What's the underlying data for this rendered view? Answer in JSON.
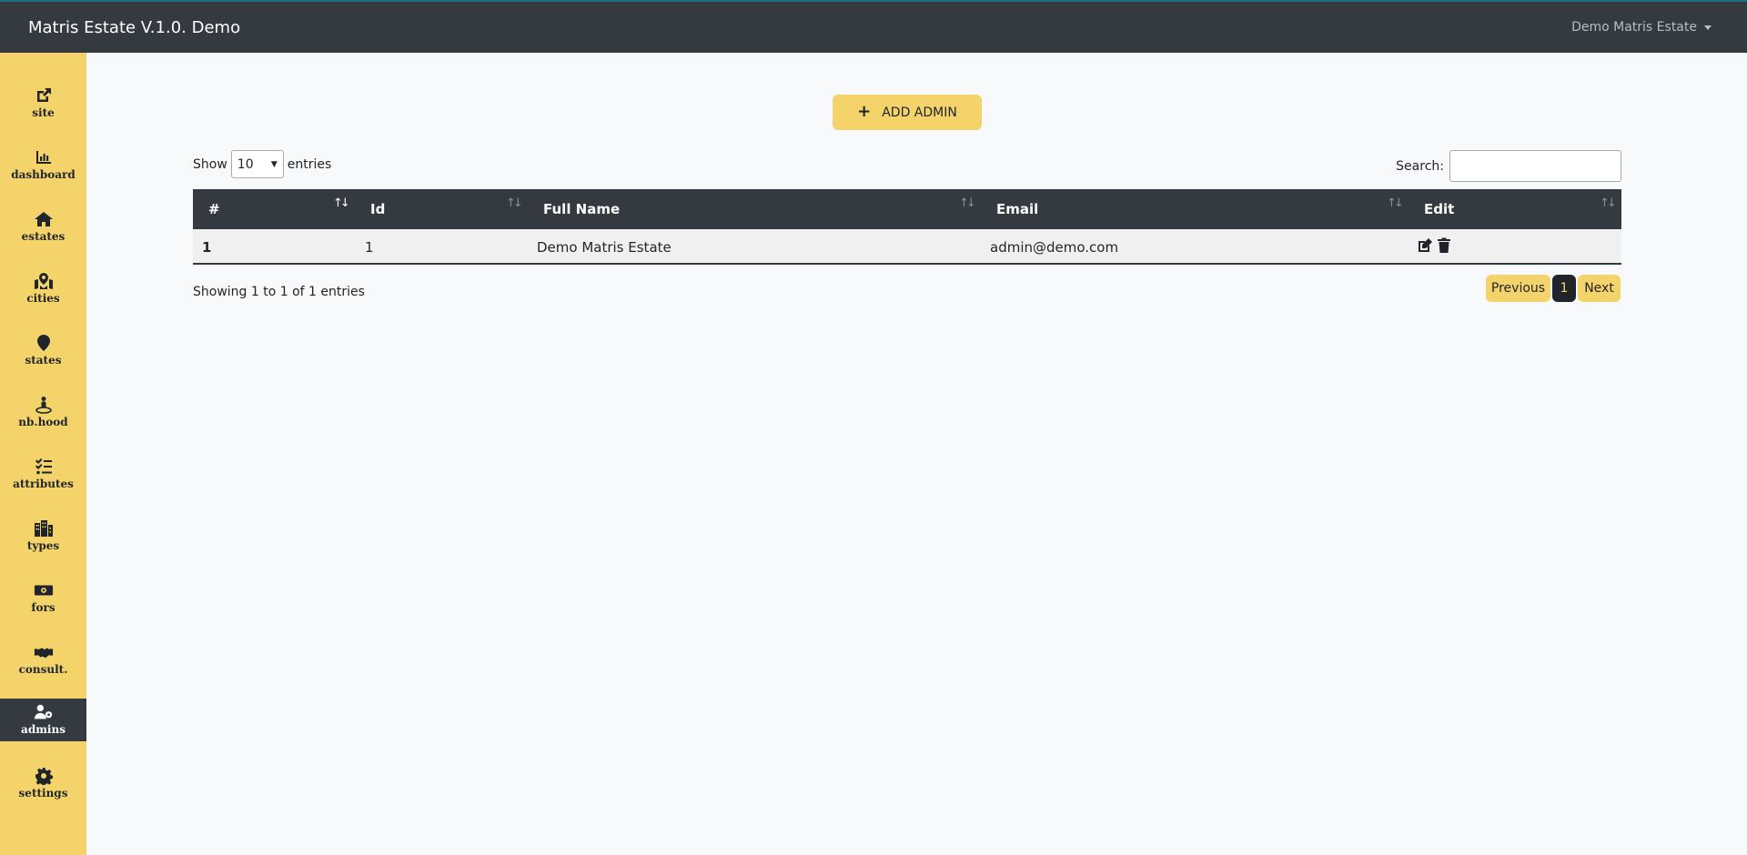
{
  "header": {
    "brand": "Matris Estate V.1.0. Demo",
    "user_menu": "Demo Matris Estate"
  },
  "sidebar": {
    "items": [
      {
        "label": "site",
        "icon": "external-link-icon"
      },
      {
        "label": "dashboard",
        "icon": "chart-bar-icon"
      },
      {
        "label": "estates",
        "icon": "home-icon"
      },
      {
        "label": "cities",
        "icon": "map-marked-icon"
      },
      {
        "label": "states",
        "icon": "map-marker-icon"
      },
      {
        "label": "nb.hood",
        "icon": "street-view-icon"
      },
      {
        "label": "attributes",
        "icon": "tasks-icon"
      },
      {
        "label": "types",
        "icon": "building-icon"
      },
      {
        "label": "fors",
        "icon": "money-bill-icon"
      },
      {
        "label": "consult.",
        "icon": "handshake-icon"
      },
      {
        "label": "admins",
        "icon": "user-cog-icon",
        "active": true
      },
      {
        "label": "settings",
        "icon": "gear-icon"
      }
    ]
  },
  "actions": {
    "add_admin_label": "ADD ADMIN",
    "add_admin_icon": "plus-icon"
  },
  "length_control": {
    "show_label": "Show",
    "selected": "10",
    "entries_label": "entries"
  },
  "search": {
    "label": "Search:",
    "value": ""
  },
  "table": {
    "columns": [
      "#",
      "Id",
      "Full Name",
      "Email",
      "Edit"
    ],
    "rows": [
      {
        "index": "1",
        "id": "1",
        "full_name": "Demo Matris Estate",
        "email": "admin@demo.com"
      }
    ]
  },
  "footer": {
    "info": "Showing 1 to 1 of 1 entries",
    "previous": "Previous",
    "current_page": "1",
    "next": "Next"
  },
  "colors": {
    "accent": "#f4d46a",
    "dark": "#343a40",
    "background": "#f7f9fa"
  }
}
